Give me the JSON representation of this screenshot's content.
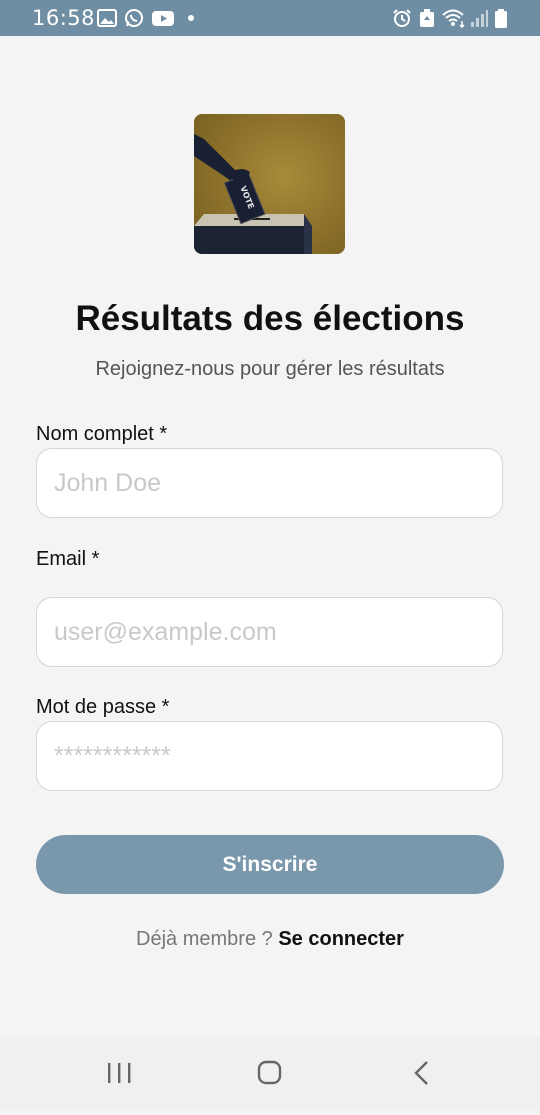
{
  "status_bar": {
    "time": "16:58",
    "left_icons": [
      "image-icon",
      "whatsapp-icon",
      "youtube-icon",
      "dot-icon"
    ],
    "right_icons": [
      "alarm-icon",
      "android-icon",
      "wifi-icon",
      "signal-icon",
      "battery-icon"
    ]
  },
  "header": {
    "logo_icon": "ballot-box-vote-icon",
    "logo_text": "VOTE",
    "title": "Résultats des élections",
    "subtitle": "Rejoignez-nous pour gérer les résultats"
  },
  "form": {
    "name_label": "Nom complet *",
    "name_placeholder": "John Doe",
    "email_label": "Email *",
    "email_placeholder": "user@example.com",
    "password_label": "Mot de passe *",
    "password_placeholder": "************",
    "submit_label": "S'inscrire"
  },
  "footer": {
    "already_member": "Déjà membre ?",
    "login_link": "Se connecter"
  },
  "nav_bar": {
    "icons": [
      "recent-apps-icon",
      "home-icon",
      "back-icon"
    ]
  },
  "colors": {
    "status_bar": "#6f8ea3",
    "background": "#f4f4f4",
    "button": "#7a98ac",
    "logo_bg": "#8c6f28"
  }
}
